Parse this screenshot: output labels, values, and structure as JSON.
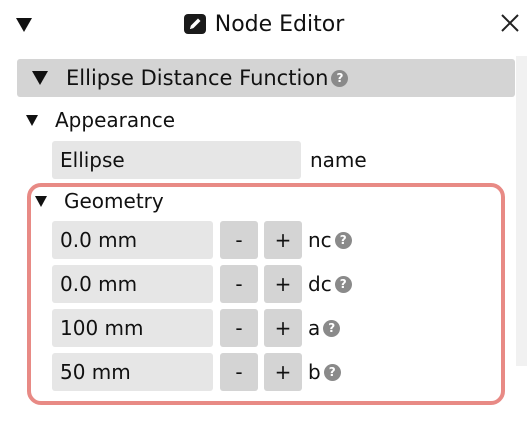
{
  "window": {
    "title": "Node Editor",
    "title_icon": "edit-icon",
    "close_icon": "close-icon"
  },
  "node": {
    "title": "Ellipse Distance Function",
    "help": "?"
  },
  "appearance": {
    "label": "Appearance",
    "name_value": "Ellipse",
    "name_label": "name"
  },
  "geometry": {
    "label": "Geometry",
    "params": [
      {
        "value": "0.0 mm",
        "minus": "-",
        "plus": "+",
        "name": "nc",
        "help": "?"
      },
      {
        "value": "0.0 mm",
        "minus": "-",
        "plus": "+",
        "name": "dc",
        "help": "?"
      },
      {
        "value": "100 mm",
        "minus": "-",
        "plus": "+",
        "name": "a",
        "help": "?"
      },
      {
        "value": "50 mm",
        "minus": "-",
        "plus": "+",
        "name": "b",
        "help": "?"
      }
    ]
  },
  "colors": {
    "header_bg": "#d4d4d4",
    "input_bg": "#e6e6e6",
    "highlight": "#e88a85"
  }
}
